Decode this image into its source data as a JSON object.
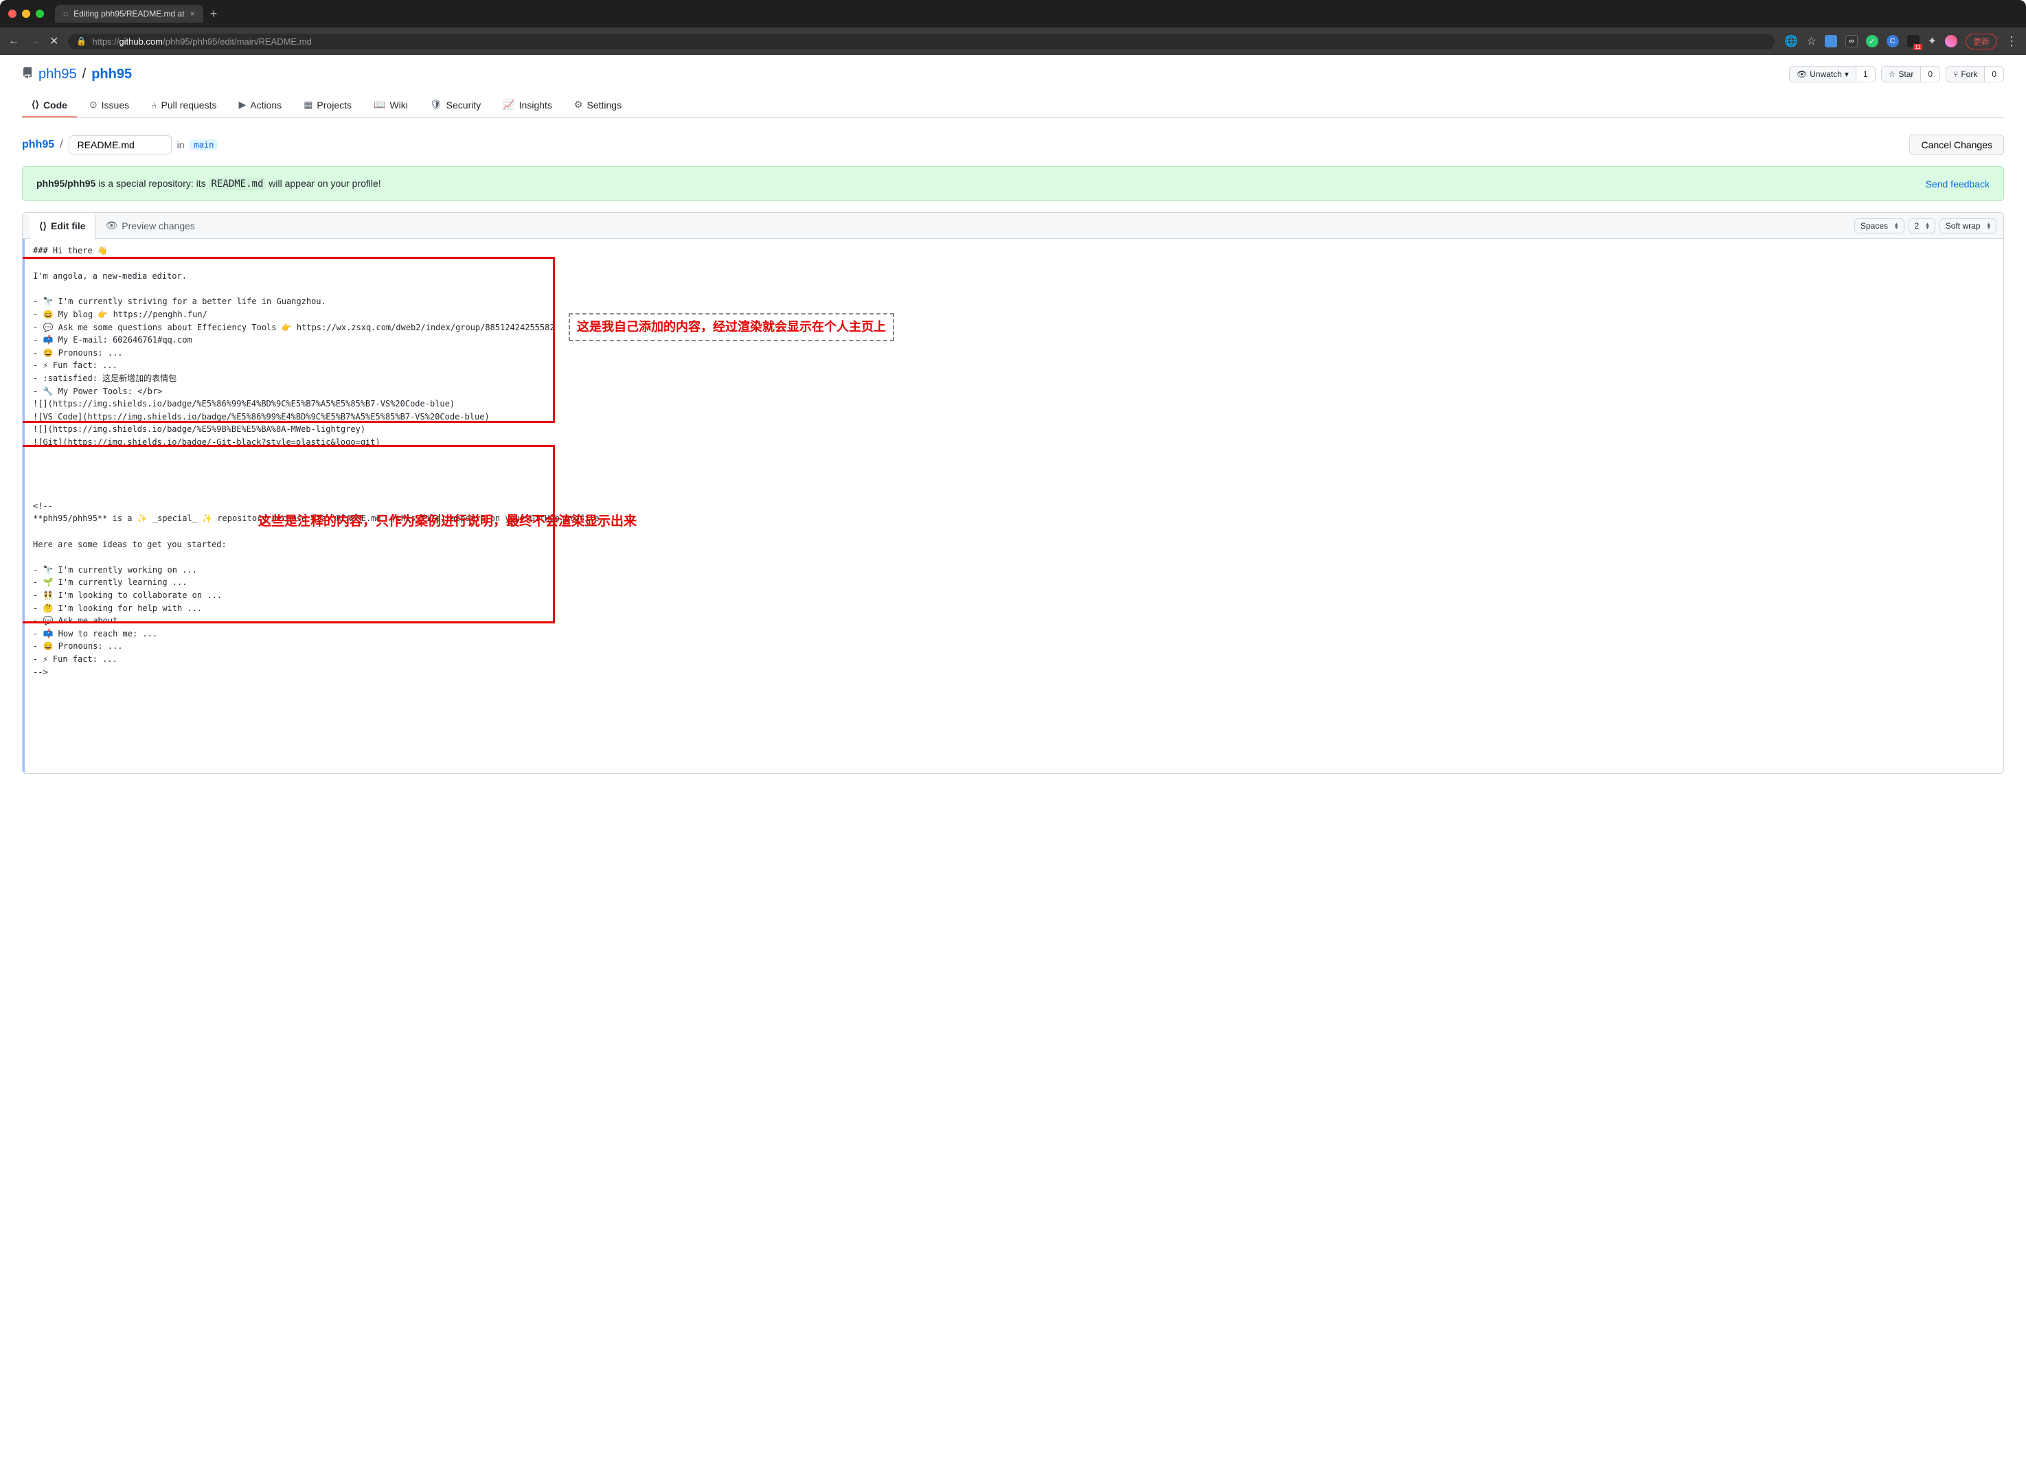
{
  "browser": {
    "tab_title": "Editing phh95/README.md at ",
    "url_protocol": "https://",
    "url_domain": "github.com",
    "url_path": "/phh95/phh95/edit/main/README.md",
    "update_label": "更新"
  },
  "repo": {
    "owner": "phh95",
    "name": "phh95",
    "actions": {
      "unwatch": "Unwatch",
      "unwatch_count": "1",
      "star": "Star",
      "star_count": "0",
      "fork": "Fork",
      "fork_count": "0"
    },
    "nav": {
      "code": "Code",
      "issues": "Issues",
      "pull_requests": "Pull requests",
      "actions": "Actions",
      "projects": "Projects",
      "wiki": "Wiki",
      "security": "Security",
      "insights": "Insights",
      "settings": "Settings"
    }
  },
  "editor": {
    "path_owner": "phh95",
    "filename": "README.md",
    "in_label": "in",
    "branch": "main",
    "cancel_label": "Cancel Changes",
    "banner_prefix": "phh95/phh95",
    "banner_mid1": " is a special repository: its ",
    "banner_code": "README.md",
    "banner_mid2": " will appear on your profile!",
    "feedback_label": "Send feedback",
    "tab_edit": "Edit file",
    "tab_preview": "Preview changes",
    "indent_mode": "Spaces",
    "indent_size": "2",
    "wrap_mode": "Soft wrap"
  },
  "code_lines": [
    "### Hi there 👋",
    "",
    "I'm angola, a new-media editor.",
    "",
    "- 🔭 I'm currently striving for a better life in Guangzhou.",
    "- 😄 My blog 👉 https://penghh.fun/",
    "- 💬 Ask me some questions about Effeciency Tools 👉 https://wx.zsxq.com/dweb2/index/group/88512424255582",
    "- 📫 My E-mail: 602646761#qq.com",
    "- 😄 Pronouns: ...",
    "- ⚡ Fun fact: ...",
    "- :satisfied: 这是新增加的表情包",
    "- 🔧 My Power Tools: </br>",
    "![](https://img.shields.io/badge/%E5%86%99%E4%BD%9C%E5%B7%A5%E5%85%B7-VS%20Code-blue)",
    "![VS Code](https://img.shields.io/badge/%E5%86%99%E4%BD%9C%E5%B7%A5%E5%85%B7-VS%20Code-blue)",
    "![](https://img.shields.io/badge/%E5%9B%BE%E5%BA%8A-MWeb-lightgrey)",
    "![Git](https://img.shields.io/badge/-Git-black?style=plastic&logo=git)",
    "",
    "",
    "",
    "",
    "<!--",
    "**phh95/phh95** is a ✨ _special_ ✨ repository because its `README.md` (this file) appears on your GitHub profile.",
    "",
    "Here are some ideas to get you started:",
    "",
    "- 🔭 I'm currently working on ...",
    "- 🌱 I'm currently learning ...",
    "- 👯 I'm looking to collaborate on ...",
    "- 🤔 I'm looking for help with ...",
    "- 💬 Ask me about ...",
    "- 📫 How to reach me: ...",
    "- 😄 Pronouns: ...",
    "- ⚡ Fun fact: ...",
    "-->"
  ],
  "annotations": {
    "box1_label": "这是我自己添加的内容，经过渲染就会显示在个人主页上",
    "box2_label": "这些是注释的内容，只作为案例进行说明，最终不会渲染显示出来"
  }
}
